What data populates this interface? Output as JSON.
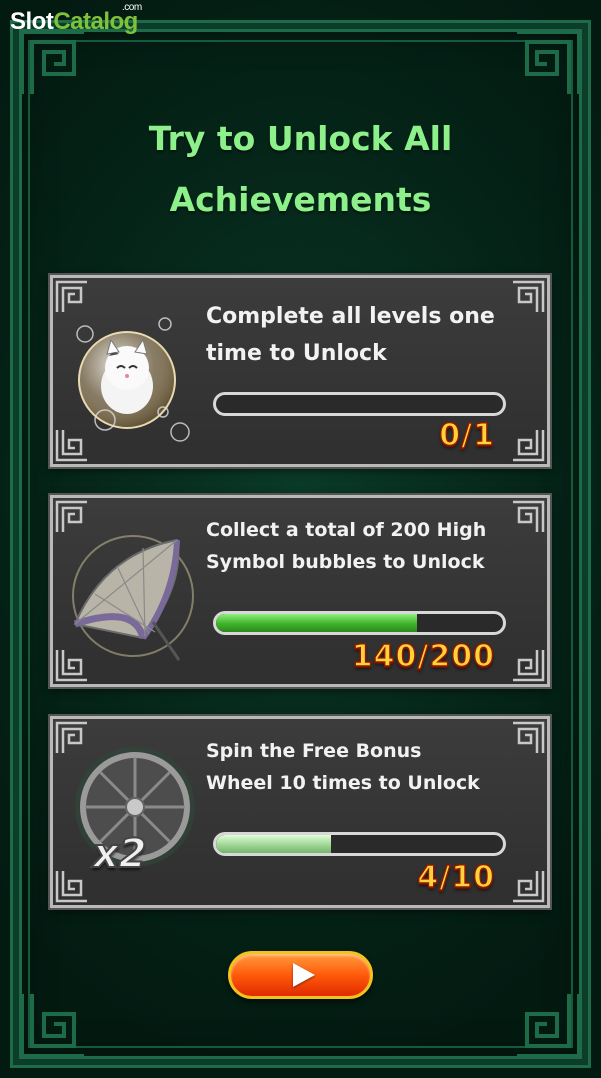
{
  "watermark": {
    "slot": "Slot",
    "catalog": "Catalog",
    "com": ".com"
  },
  "title": {
    "line1": "Try to Unlock All",
    "line2": "Achievements"
  },
  "achievements": [
    {
      "icon": "lucky-cat-bubble-icon",
      "desc_line1": "Complete all levels one",
      "desc_line2": "time to Unlock",
      "progress": 0.0,
      "count": "0/1"
    },
    {
      "icon": "umbrella-icon",
      "desc_line1": "Collect a total of 200 High",
      "desc_line2": "Symbol bubbles to Unlock",
      "progress": 0.7,
      "count": "140/200"
    },
    {
      "icon": "bonus-wheel-icon",
      "desc_line1": "Spin the Free Bonus",
      "desc_line2": "Wheel 10 times to Unlock",
      "progress": 0.4,
      "count": "4/10",
      "badge": "x2"
    }
  ],
  "play_button": {
    "icon": "play-icon"
  },
  "colors": {
    "title": "#8df08a",
    "count": "#ffd23a",
    "bar_fill": "#3eb22a",
    "frame": "#1e6b4a"
  }
}
